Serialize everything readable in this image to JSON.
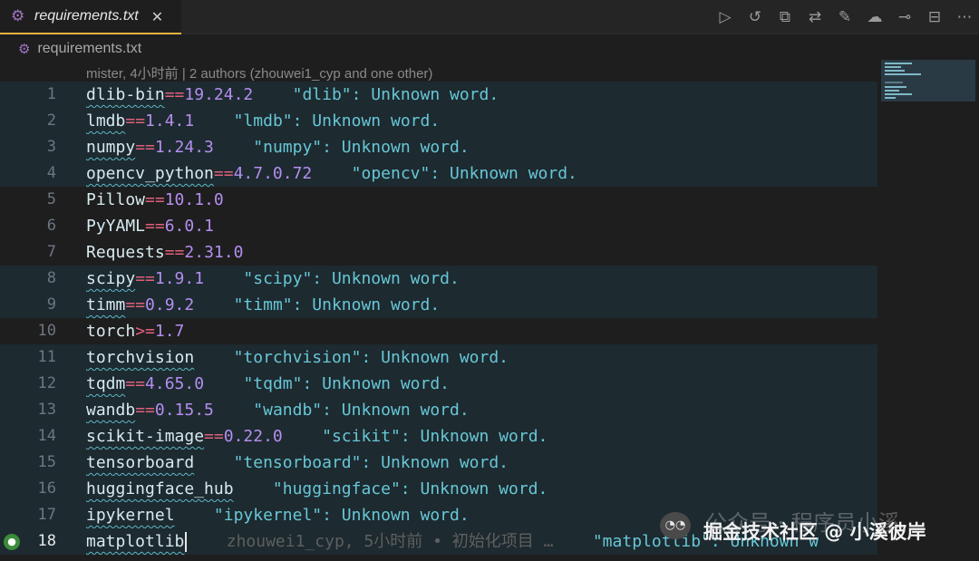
{
  "tab": {
    "title": "requirements.txt",
    "close_glyph": "✕"
  },
  "breadcrumb": {
    "file": "requirements.txt"
  },
  "codelens": "mister, 4小时前 | 2 authors (zhouwei1_cyp and one other)",
  "lines": [
    {
      "n": "1",
      "pkg": "dlib-bin",
      "op": "==",
      "ver": "19.24.2",
      "diag": "\"dlib\": Unknown word."
    },
    {
      "n": "2",
      "pkg": "lmdb",
      "op": "==",
      "ver": "1.4.1",
      "diag": "\"lmdb\": Unknown word."
    },
    {
      "n": "3",
      "pkg": "numpy",
      "op": "==",
      "ver": "1.24.3",
      "diag": "\"numpy\": Unknown word."
    },
    {
      "n": "4",
      "pkg": "opencv_python",
      "op": "==",
      "ver": "4.7.0.72",
      "diag": "\"opencv\": Unknown word."
    },
    {
      "n": "5",
      "pkg": "Pillow",
      "op": "==",
      "ver": "10.1.0",
      "diag": ""
    },
    {
      "n": "6",
      "pkg": "PyYAML",
      "op": "==",
      "ver": "6.0.1",
      "diag": ""
    },
    {
      "n": "7",
      "pkg": "Requests",
      "op": "==",
      "ver": "2.31.0",
      "diag": ""
    },
    {
      "n": "8",
      "pkg": "scipy",
      "op": "==",
      "ver": "1.9.1",
      "diag": "\"scipy\": Unknown word."
    },
    {
      "n": "9",
      "pkg": "timm",
      "op": "==",
      "ver": "0.9.2",
      "diag": "\"timm\": Unknown word."
    },
    {
      "n": "10",
      "pkg": "torch",
      "op": ">=",
      "ver": "1.7",
      "diag": ""
    },
    {
      "n": "11",
      "pkg": "torchvision",
      "op": "",
      "ver": "",
      "diag": "\"torchvision\": Unknown word."
    },
    {
      "n": "12",
      "pkg": "tqdm",
      "op": "==",
      "ver": "4.65.0",
      "diag": "\"tqdm\": Unknown word."
    },
    {
      "n": "13",
      "pkg": "wandb",
      "op": "==",
      "ver": "0.15.5",
      "diag": "\"wandb\": Unknown word."
    },
    {
      "n": "14",
      "pkg": "scikit-image",
      "op": "==",
      "ver": "0.22.0",
      "diag": "\"scikit\": Unknown word."
    },
    {
      "n": "15",
      "pkg": "tensorboard",
      "op": "",
      "ver": "",
      "diag": "\"tensorboard\": Unknown word."
    },
    {
      "n": "16",
      "pkg": "huggingface_hub",
      "op": "",
      "ver": "",
      "diag": "\"huggingface\": Unknown word."
    },
    {
      "n": "17",
      "pkg": "ipykernel",
      "op": "",
      "ver": "",
      "diag": "\"ipykernel\": Unknown word."
    },
    {
      "n": "18",
      "pkg": "matplotlib",
      "op": "",
      "ver": "",
      "blame": "zhouwei1_cyp, 5小时前 • 初始化项目 …",
      "diag": "\"matplotlib\": Unknown w"
    }
  ],
  "watermark": {
    "line1": "公众号 · 程序员小溪",
    "line2": "掘金技术社区 @ 小溪彼岸"
  },
  "colors": {
    "accent_tab": "#e2b340",
    "keyword_op": "#e0607a",
    "version": "#b48ef0",
    "diagnostic": "#67c7d6"
  }
}
